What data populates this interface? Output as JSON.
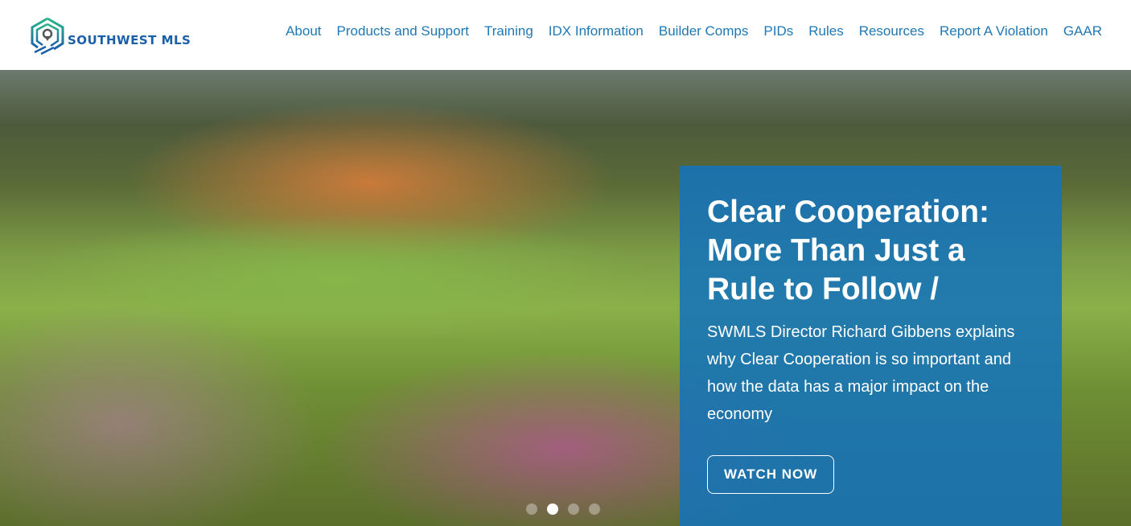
{
  "header": {
    "logo_text": "SOUTHWEST MLS",
    "nav": [
      "About",
      "Products and Support",
      "Training",
      "IDX Information",
      "Builder Comps",
      "PIDs",
      "Rules",
      "Resources",
      "Report A Violation",
      "GAAR"
    ]
  },
  "hero": {
    "title": "Clear Cooperation: More Than Just a Rule to Follow /",
    "description": "SWMLS Director Richard Gibbens explains why Clear Cooperation is so important and how the data has a major impact on the economy",
    "cta": "WATCH NOW",
    "slide_count": 4,
    "active_slide": 2
  },
  "colors": {
    "brand": "#1a5fa8",
    "nav": "#1f78b4",
    "panel": "#1473b9"
  }
}
